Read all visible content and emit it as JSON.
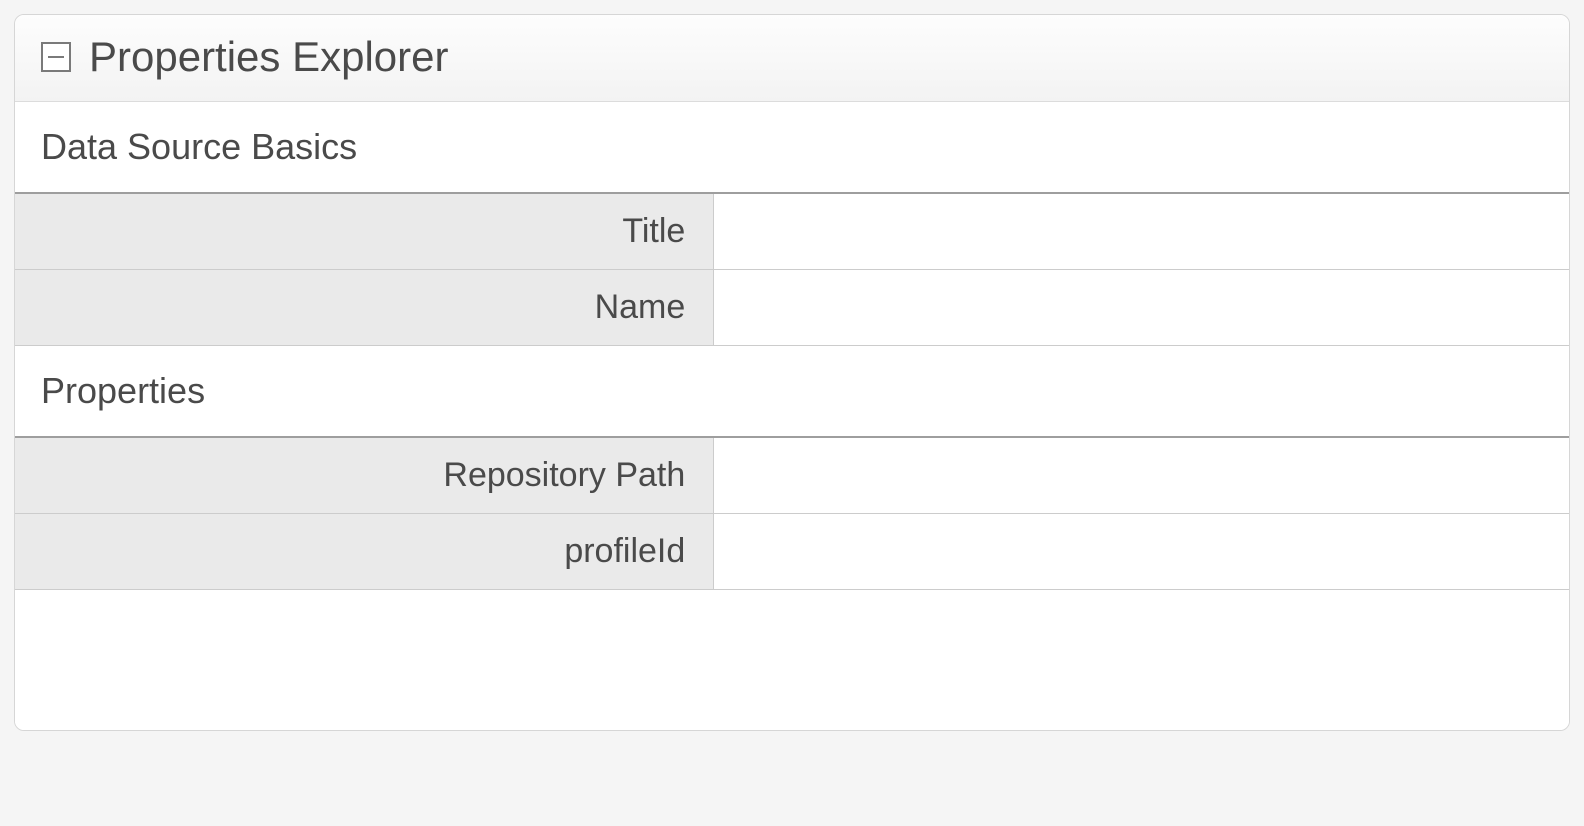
{
  "panel": {
    "title": "Properties Explorer"
  },
  "sections": {
    "basics": {
      "header": "Data Source Basics",
      "rows": {
        "title": {
          "label": "Title",
          "value": ""
        },
        "name": {
          "label": "Name",
          "value": ""
        }
      }
    },
    "properties": {
      "header": "Properties",
      "rows": {
        "repositoryPath": {
          "label": "Repository Path",
          "value": ""
        },
        "profileId": {
          "label": "profileId",
          "value": ""
        }
      }
    }
  }
}
